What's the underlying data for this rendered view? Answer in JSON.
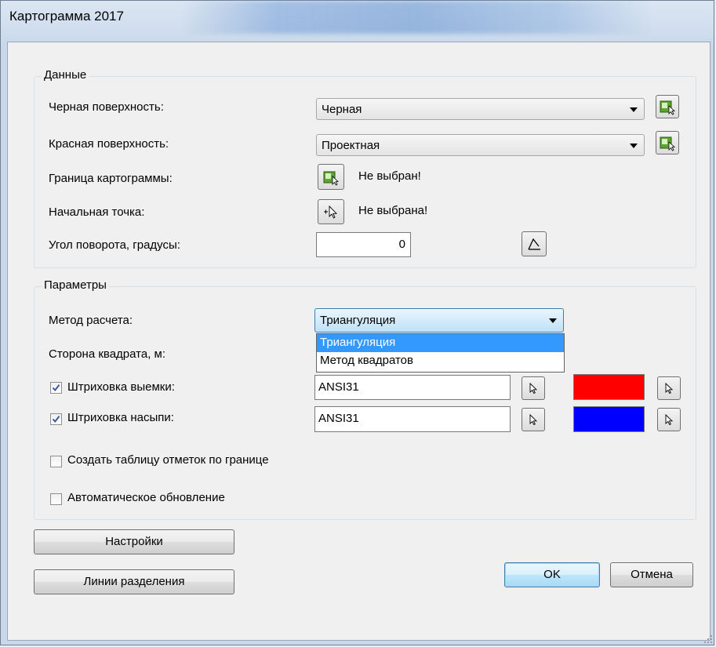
{
  "window": {
    "title": "Картограмма 2017"
  },
  "data_group": {
    "title": "Данные",
    "black_surface_label": "Черная поверхность:",
    "black_surface_value": "Черная",
    "red_surface_label": "Красная поверхность:",
    "red_surface_value": "Проектная",
    "boundary_label": "Граница картограммы:",
    "boundary_status": "Не выбран!",
    "start_point_label": "Начальная точка:",
    "start_point_status": "Не выбрана!",
    "rotation_label": "Угол поворота, градусы:",
    "rotation_value": "0"
  },
  "params_group": {
    "title": "Параметры",
    "method_label": "Метод расчета:",
    "method_value": "Триангуляция",
    "method_options": [
      "Триангуляция",
      "Метод квадратов"
    ],
    "square_side_label": "Сторона квадрата, м:",
    "cut_hatch_label": "Штриховка выемки:",
    "cut_hatch_checked": true,
    "cut_hatch_value": "ANSI31",
    "cut_color": "#ff0000",
    "fill_hatch_label": "Штриховка насыпи:",
    "fill_hatch_checked": true,
    "fill_hatch_value": "ANSI31",
    "fill_color": "#0000ff",
    "create_table_label": "Создать таблицу отметок по границе",
    "create_table_checked": false,
    "auto_update_label": "Автоматическое обновление",
    "auto_update_checked": false
  },
  "buttons": {
    "settings": "Настройки",
    "division_lines": "Линии разделения",
    "ok": "OK",
    "cancel": "Отмена"
  }
}
